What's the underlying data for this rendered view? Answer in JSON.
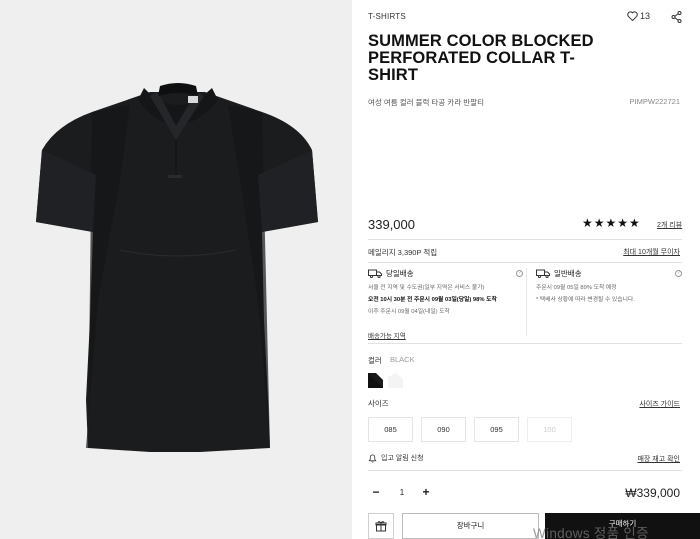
{
  "product": {
    "category": "T-SHIRTS",
    "likes": "13",
    "title": "SUMMER COLOR BLOCKED PERFORATED COLLAR T-SHIRT",
    "subtitle_kr": "여성 여름 컬러 블럭 타공 카라 반팔티",
    "code": "PIMPW222721",
    "price": "339,000",
    "rating_stars": "★★★★★",
    "review_link": "2개 리뷰"
  },
  "benefits": {
    "mileage": "메일리지 3,390P 적립",
    "installment": "최대 10개월 무이자"
  },
  "shipping": {
    "sameday": {
      "title": "당일배송",
      "line1": "서울 전 지역 및 수도권(일부 지역은 서비스 불가)",
      "line2": "오전 10시 30분 전 주문시 09월 03일(당일) 98% 도착",
      "line3": "이후 주문시 09월 04일(내일) 도착"
    },
    "normal": {
      "title": "일반배송",
      "line1": "주문시 09월 05일 89% 도착 예정",
      "line2": "* 택배사 상황에 따라 변경될 수 있습니다."
    },
    "area_link": "배송가능 지역"
  },
  "options": {
    "color_label": "컬러",
    "color_value": "BLACK",
    "size_label": "사이즈",
    "size_guide": "사이즈 가이드",
    "sizes": [
      "085",
      "090",
      "095",
      "100"
    ],
    "restock": "입고 알림 신청",
    "store_stock": "매장 재고 확인"
  },
  "purchase": {
    "quantity": "1",
    "minus": "−",
    "plus": "+",
    "total": "₩339,000",
    "cart_label": "장바구니",
    "buy_label": "구매하기"
  },
  "overlay": {
    "watermark": "Windows 정품 인증"
  },
  "colors": {
    "swatch_black": "#111111",
    "swatch_white": "#ffffff",
    "buy_button": "#111111"
  },
  "icons": [
    "heart-icon",
    "share-icon",
    "truck-icon",
    "help-icon",
    "bell-icon",
    "gift-icon"
  ]
}
